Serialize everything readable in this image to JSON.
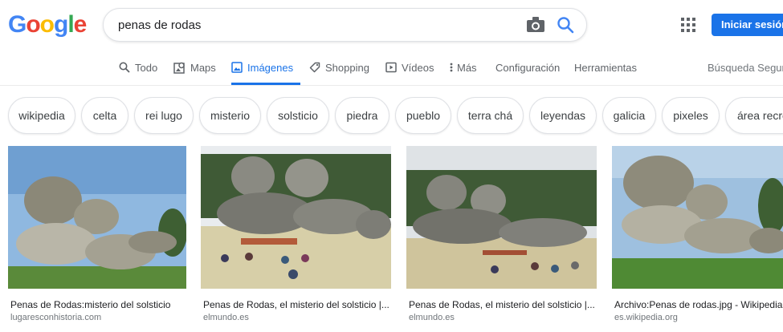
{
  "logo": {
    "letters": [
      "G",
      "o",
      "o",
      "g",
      "l",
      "e"
    ],
    "colors": [
      "#4285f4",
      "#ea4335",
      "#fbbc05",
      "#4285f4",
      "#34a853",
      "#ea4335"
    ]
  },
  "search": {
    "query": "penas de rodas",
    "camera_icon": "camera-icon",
    "search_icon": "magnifier-icon"
  },
  "header": {
    "apps_icon": "apps-grid-icon",
    "signin_label": "Iniciar sesión"
  },
  "nav": {
    "tabs": [
      {
        "label": "Todo",
        "icon": "search-icon"
      },
      {
        "label": "Maps",
        "icon": "map-pin-icon"
      },
      {
        "label": "Imágenes",
        "icon": "image-icon",
        "active": true
      },
      {
        "label": "Shopping",
        "icon": "tag-icon"
      },
      {
        "label": "Vídeos",
        "icon": "play-icon"
      },
      {
        "label": "Más",
        "icon": "more-vert-icon"
      }
    ],
    "settings_label": "Configuración",
    "tools_label": "Herramientas",
    "safesearch_label": "Búsqueda Segura"
  },
  "chips": [
    "wikipedia",
    "celta",
    "rei lugo",
    "misterio",
    "solsticio",
    "piedra",
    "pueblo",
    "terra chá",
    "leyendas",
    "galicia",
    "pixeles",
    "área recreativa"
  ],
  "results": [
    {
      "caption": "Penas de Rodas:misterio del solsticio",
      "source": "lugaresconhistoria.com"
    },
    {
      "caption": "Penas de Rodas, el misterio del solsticio |...",
      "source": "elmundo.es"
    },
    {
      "caption": "Penas de Rodas, el misterio del solsticio |...",
      "source": "elmundo.es"
    },
    {
      "caption": "Archivo:Penas de rodas.jpg - Wikipedia, la",
      "source": "es.wikipedia.org"
    }
  ],
  "colors": {
    "accent": "#1a73e8",
    "muted": "#5f6368",
    "sky": "#8fb8e0",
    "grass": "#5a8a3a",
    "rock": "#9a9a8c"
  }
}
